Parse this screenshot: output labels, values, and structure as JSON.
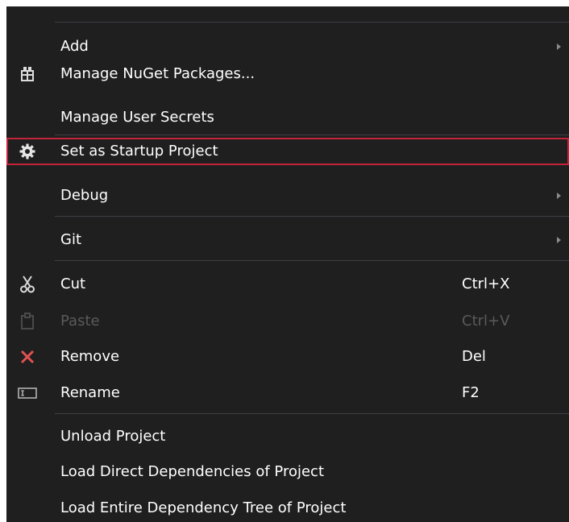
{
  "menu": {
    "items": [
      {
        "label": "Add"
      },
      {
        "label": "Manage NuGet Packages..."
      },
      {
        "label": "Manage User Secrets"
      },
      {
        "label": "Set as Startup Project"
      },
      {
        "label": "Debug"
      },
      {
        "label": "Git"
      },
      {
        "label": "Cut",
        "shortcut": "Ctrl+X"
      },
      {
        "label": "Paste",
        "shortcut": "Ctrl+V"
      },
      {
        "label": "Remove",
        "shortcut": "Del"
      },
      {
        "label": "Rename",
        "shortcut": "F2"
      },
      {
        "label": "Unload Project"
      },
      {
        "label": "Load Direct Dependencies of Project"
      },
      {
        "label": "Load Entire Dependency Tree of Project"
      }
    ]
  },
  "colors": {
    "menu_bg": "#1f1f1f",
    "separator": "#3f3f46",
    "highlight_border": "#c4233a",
    "remove_icon": "#e0524f",
    "disabled_text": "#5a5a5a"
  }
}
